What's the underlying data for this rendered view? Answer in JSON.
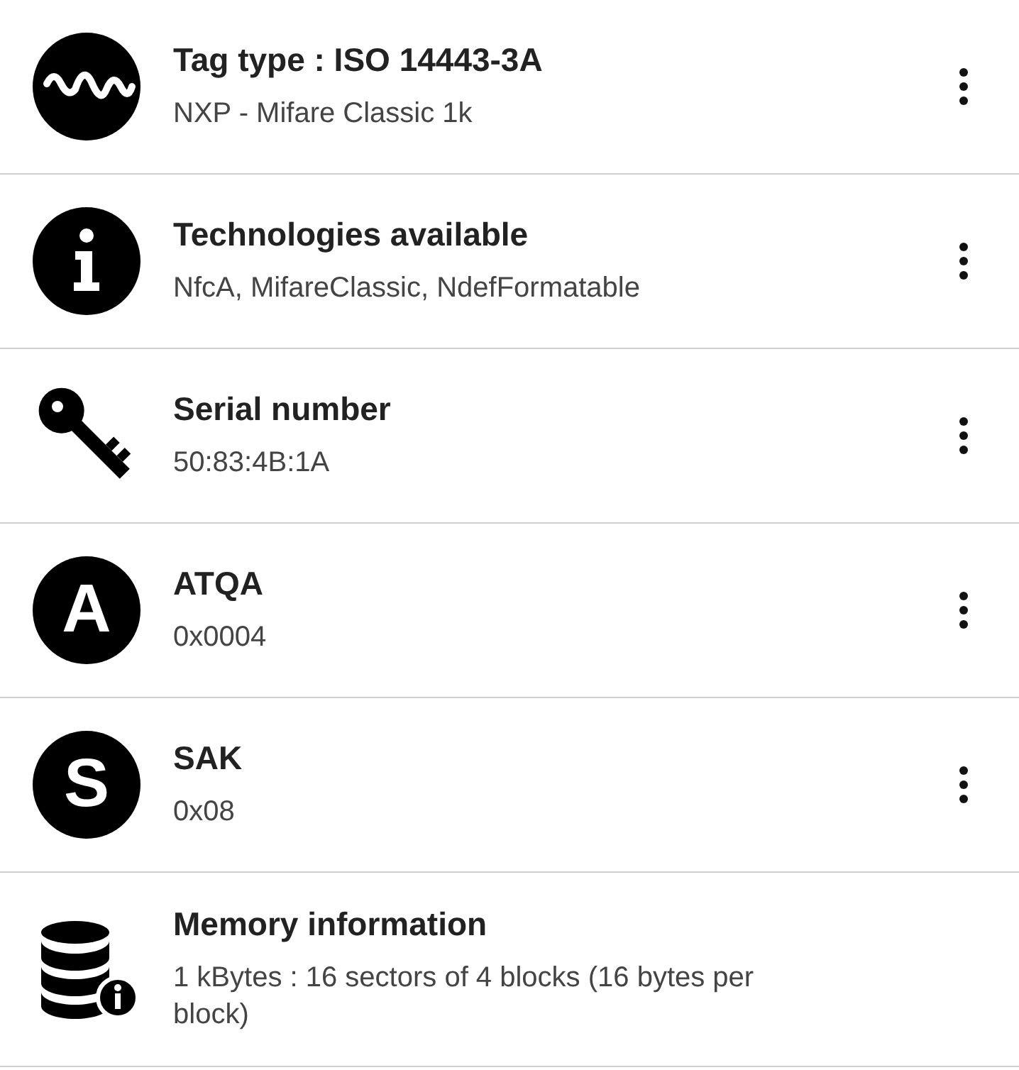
{
  "items": [
    {
      "kind": "wave",
      "title": "Tag type : ISO 14443-3A",
      "subtitle": "NXP - Mifare Classic 1k",
      "menu": true
    },
    {
      "kind": "info",
      "title": "Technologies available",
      "subtitle": "NfcA, MifareClassic, NdefFormatable",
      "menu": true
    },
    {
      "kind": "key",
      "title": "Serial number",
      "subtitle": "50:83:4B:1A",
      "menu": true
    },
    {
      "kind": "letter",
      "letter": "A",
      "title": "ATQA",
      "subtitle": "0x0004",
      "menu": true
    },
    {
      "kind": "letter",
      "letter": "S",
      "title": "SAK",
      "subtitle": "0x08",
      "menu": true
    },
    {
      "kind": "database",
      "title": "Memory information",
      "subtitle": "1 kBytes : 16 sectors of 4 blocks (16 bytes per block)",
      "menu": false
    }
  ]
}
